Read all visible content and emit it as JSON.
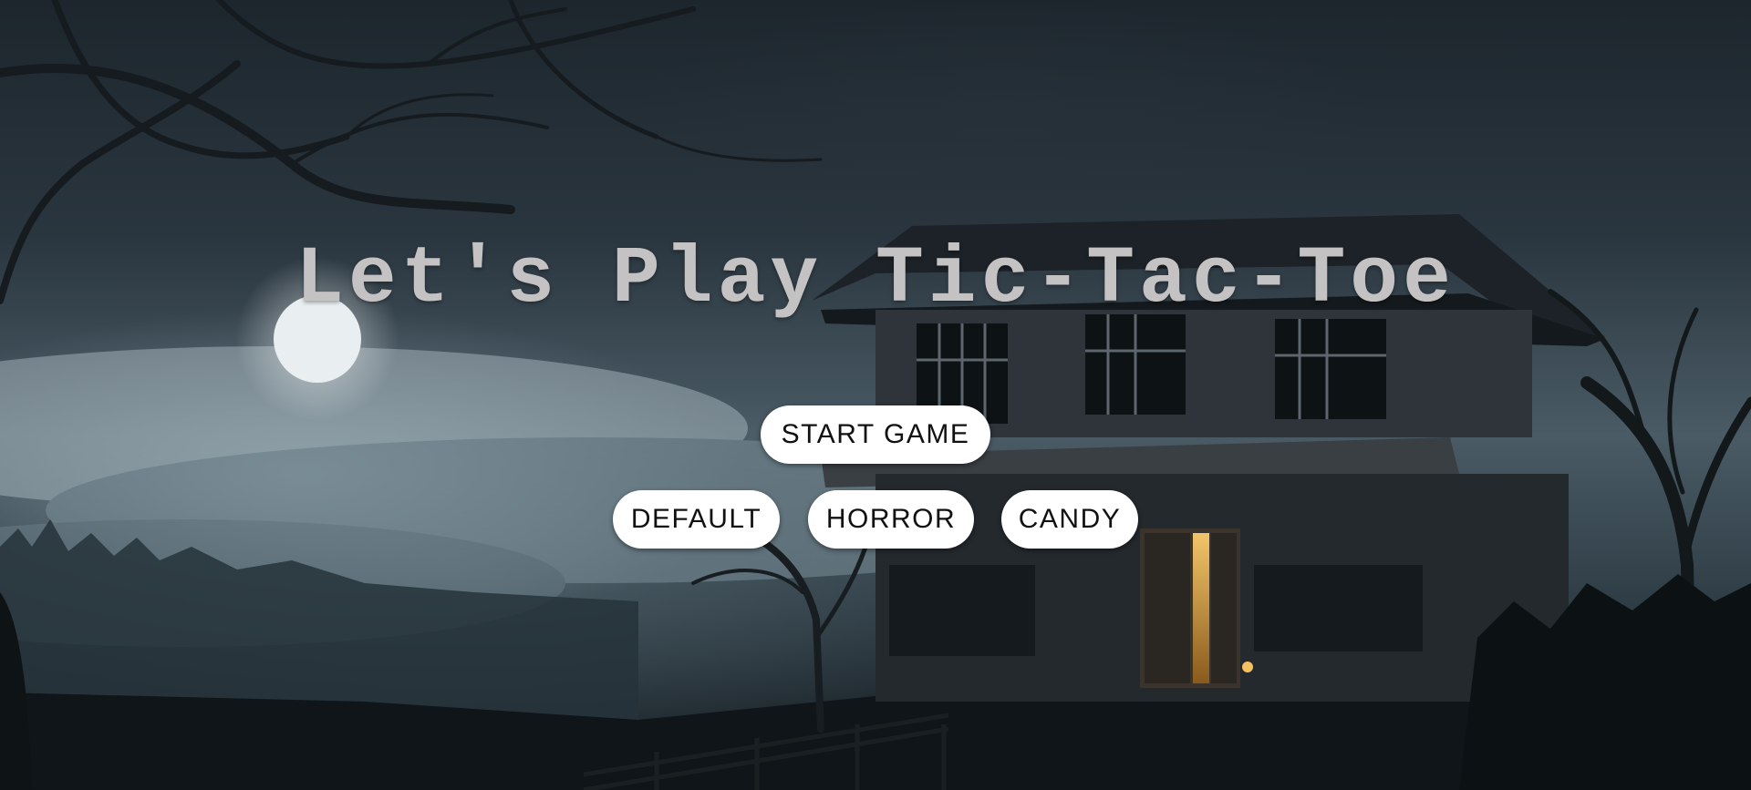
{
  "title": "Let's Play Tic-Tac-Toe",
  "buttons": {
    "start": "START GAME",
    "default": "DEFAULT",
    "horror": "HORROR",
    "candy": "CANDY"
  },
  "colors": {
    "title_text": "#c4c2c2",
    "button_bg": "#ffffff",
    "button_text": "#111111"
  },
  "background": "haunted-house-night-scene"
}
